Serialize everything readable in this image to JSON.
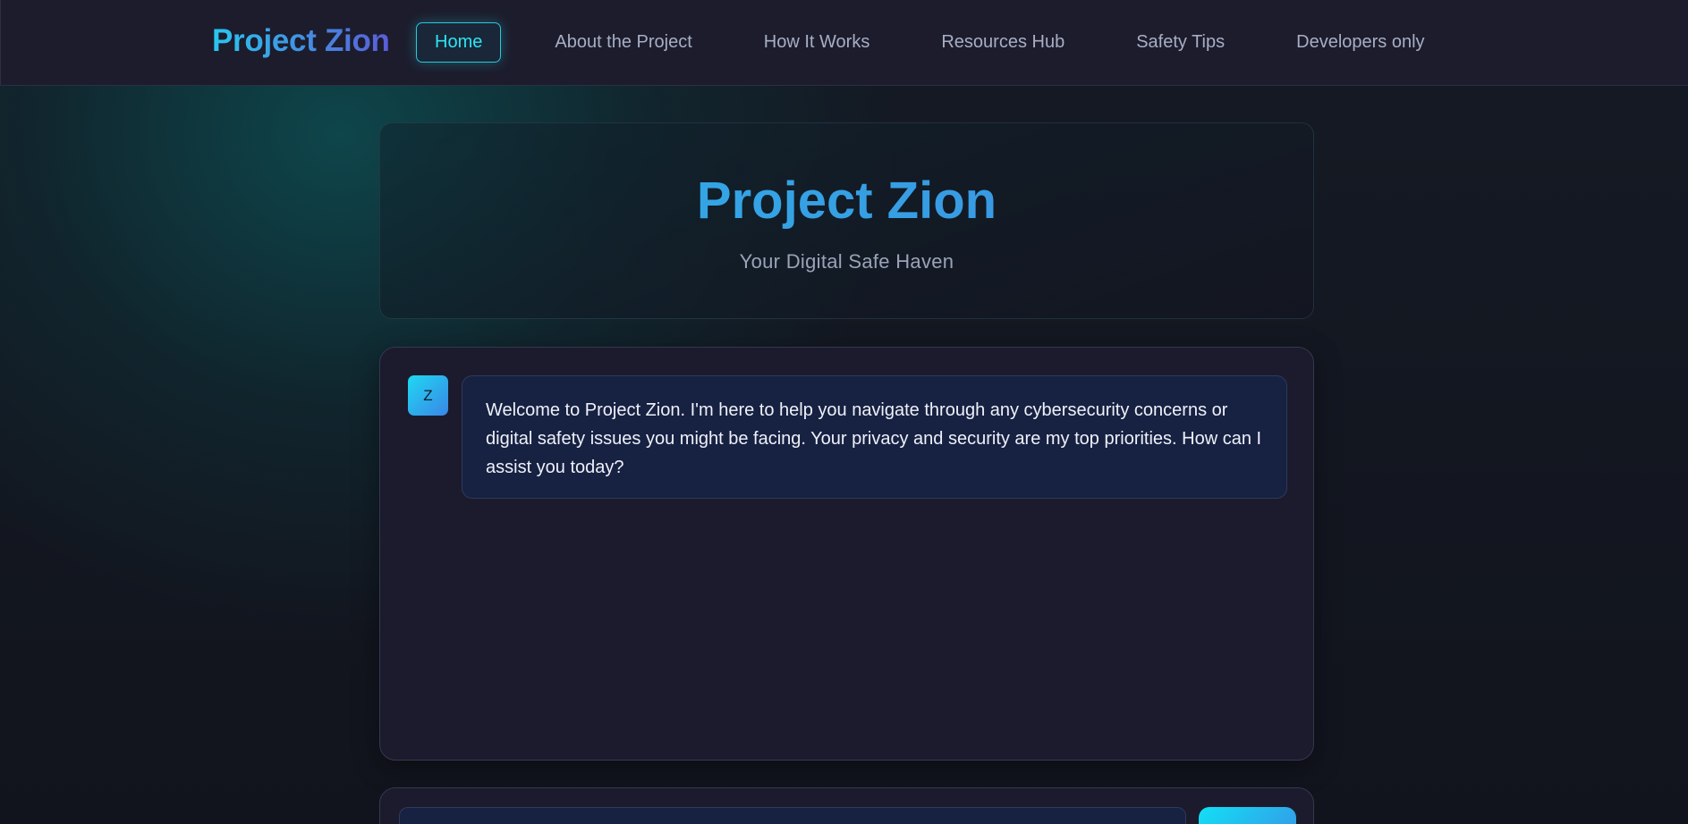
{
  "app": {
    "brand": "Project Zion"
  },
  "nav": {
    "items": [
      {
        "label": "Home",
        "active": true
      },
      {
        "label": "About the Project",
        "active": false
      },
      {
        "label": "How It Works",
        "active": false
      },
      {
        "label": "Resources Hub",
        "active": false
      },
      {
        "label": "Safety Tips",
        "active": false
      },
      {
        "label": "Developers only",
        "active": false
      }
    ]
  },
  "hero": {
    "title": "Project Zion",
    "subtitle": "Your Digital Safe Haven"
  },
  "chat": {
    "messages": [
      {
        "sender_initial": "Z",
        "text": "Welcome to Project Zion. I'm here to help you navigate through any cybersecurity concerns or digital safety issues you might be facing. Your privacy and security are my top priorities. How can I assist you today?"
      }
    ]
  },
  "composer": {
    "input_value": "",
    "placeholder": "",
    "send_label": ""
  },
  "colors": {
    "accent_cyan": "#2ee4f4",
    "brand_gradient_start": "#29c6ef",
    "brand_gradient_end": "#5b5cd6",
    "bubble_bg": "#172142",
    "page_bg": "#14141f"
  }
}
